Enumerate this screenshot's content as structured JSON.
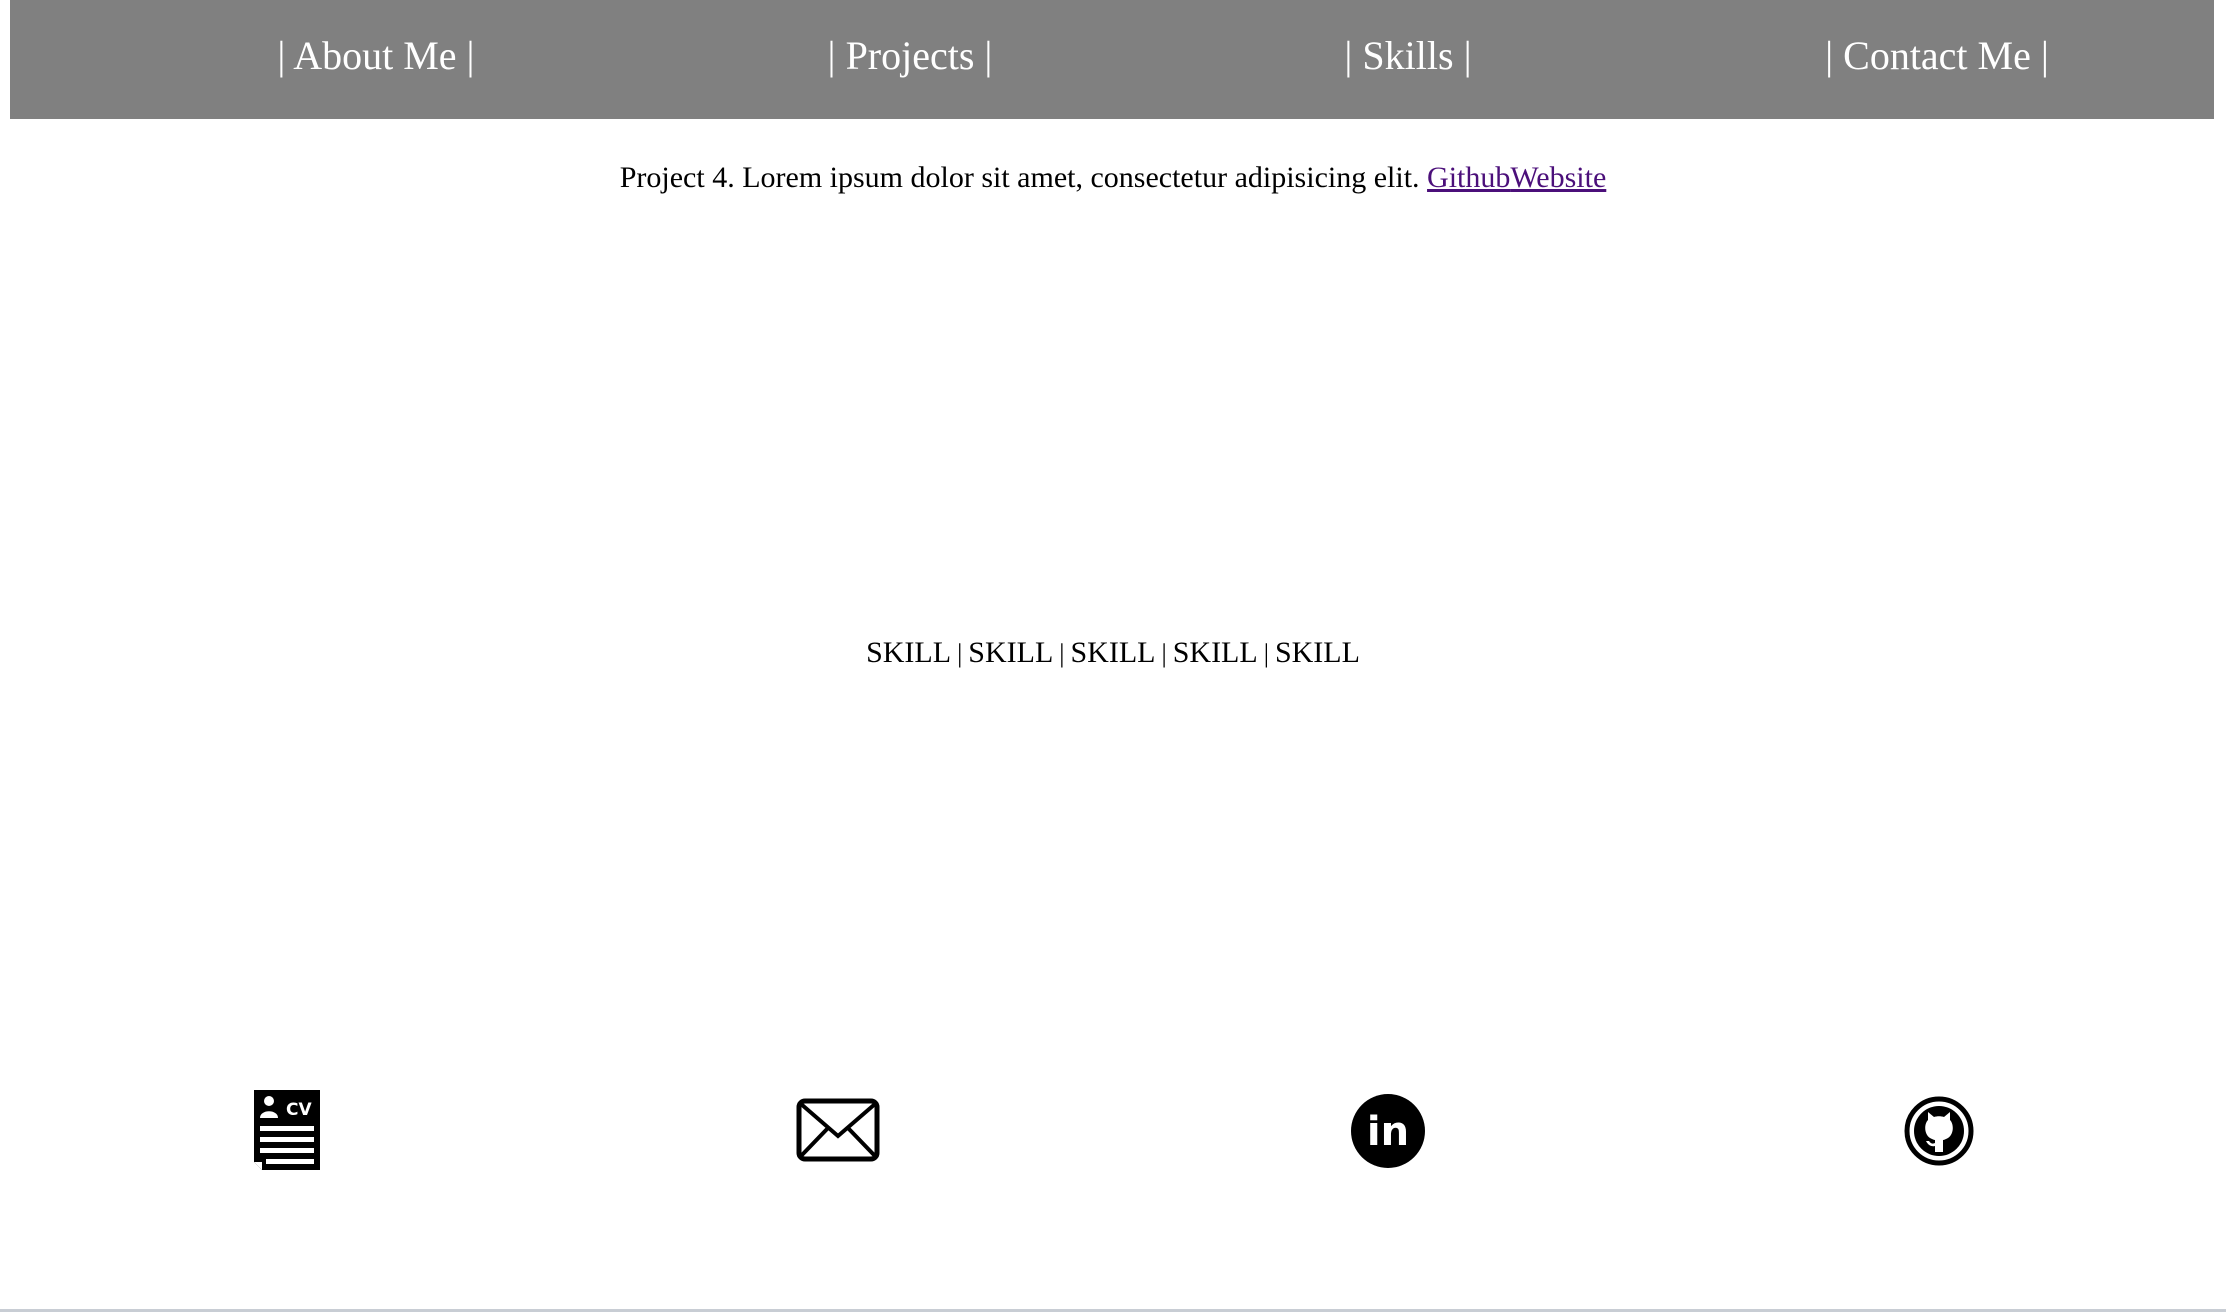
{
  "nav": {
    "items": [
      {
        "label": "| About Me |"
      },
      {
        "label": "| Projects |"
      },
      {
        "label": "| Skills |"
      },
      {
        "label": "| Contact Me |"
      }
    ],
    "background_color": "#808080",
    "text_color": "#ffffff"
  },
  "project": {
    "text": "Project 4. Lorem ipsum dolor sit amet, consectetur adipisicing elit.",
    "links": [
      {
        "label": "Github"
      },
      {
        "label": "Website"
      }
    ],
    "link_color": "#4b0f7a"
  },
  "skills": {
    "items": [
      "SKILL",
      "SKILL",
      "SKILL",
      "SKILL",
      "SKILL"
    ],
    "separator": "|"
  },
  "footer": {
    "icons": [
      {
        "name": "cv-document-icon",
        "text": "CV"
      },
      {
        "name": "mail-envelope-icon"
      },
      {
        "name": "linkedin-icon",
        "text": "in"
      },
      {
        "name": "github-icon"
      }
    ]
  }
}
